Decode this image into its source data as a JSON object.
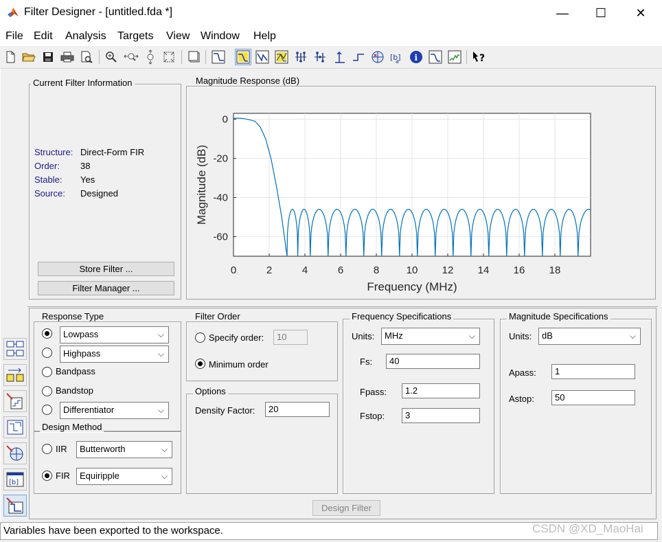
{
  "window": {
    "title": "Filter Designer -  [untitled.fda *]",
    "controls": {
      "minimize": "—",
      "maximize": "☐",
      "close": "✕"
    }
  },
  "menu": [
    "File",
    "Edit",
    "Analysis",
    "Targets",
    "View",
    "Window",
    "Help"
  ],
  "filter_info": {
    "title": "Current Filter Information",
    "rows": [
      {
        "label": "Structure:",
        "value": "Direct-Form FIR"
      },
      {
        "label": "Order:",
        "value": "38"
      },
      {
        "label": "Stable:",
        "value": "Yes"
      },
      {
        "label": "Source:",
        "value": "Designed"
      }
    ],
    "store_button": "Store Filter ...",
    "manager_button": "Filter Manager ..."
  },
  "plot": {
    "title": "Magnitude Response (dB)",
    "xlabel": "Frequency (MHz)",
    "ylabel": "Magnitude (dB)",
    "xticks": [
      "0",
      "2",
      "4",
      "6",
      "8",
      "10",
      "12",
      "14",
      "16",
      "18"
    ],
    "yticks": [
      "0",
      "-20",
      "-40",
      "-60"
    ],
    "line_color": "#0072bd"
  },
  "chart_data": {
    "type": "line",
    "title": "",
    "xlabel": "Frequency (MHz)",
    "ylabel": "Magnitude (dB)",
    "xlim": [
      0,
      20
    ],
    "ylim": [
      -70,
      3
    ],
    "grid": true,
    "series": [
      {
        "passband_x": [
          0,
          0.3,
          0.6,
          0.9,
          1.2,
          1.5,
          1.8,
          2.1,
          2.4,
          2.7,
          3.0
        ],
        "passband_y": [
          0.5,
          0.5,
          0.3,
          -0.3,
          -1,
          -4,
          -10,
          -20,
          -34,
          -50,
          -70
        ],
        "ripple_peak_db": -46,
        "ripple_nulls_mhz": [
          3.0,
          3.6,
          4.3,
          5.3,
          6.3,
          7.3,
          8.3,
          9.3,
          10.3,
          11.3,
          12.3,
          13.3,
          14.3,
          15.3,
          16.3,
          17.3,
          18.3,
          19.3
        ]
      }
    ]
  },
  "response_type": {
    "title": "Response Type",
    "options": [
      {
        "label": "Lowpass",
        "selected": true,
        "dropdown": true
      },
      {
        "label": "Highpass",
        "selected": false,
        "dropdown": true
      },
      {
        "label": "Bandpass",
        "selected": false,
        "dropdown": false
      },
      {
        "label": "Bandstop",
        "selected": false,
        "dropdown": false
      },
      {
        "label": "Differentiator",
        "selected": false,
        "dropdown": true
      }
    ]
  },
  "design_method": {
    "title": "Design Method",
    "iir_label": "IIR",
    "iir_value": "Butterworth",
    "fir_label": "FIR",
    "fir_value": "Equiripple"
  },
  "filter_order": {
    "title": "Filter Order",
    "specify_label": "Specify order:",
    "specify_value": "10",
    "minimum_label": "Minimum order"
  },
  "options": {
    "title": "Options",
    "density_label": "Density Factor:",
    "density_value": "20"
  },
  "freq_specs": {
    "title": "Frequency Specifications",
    "units_label": "Units:",
    "units_value": "MHz",
    "fs_label": "Fs:",
    "fs_value": "40",
    "fpass_label": "Fpass:",
    "fpass_value": "1.2",
    "fstop_label": "Fstop:",
    "fstop_value": "3"
  },
  "mag_specs": {
    "title": "Magnitude Specifications",
    "units_label": "Units:",
    "units_value": "dB",
    "apass_label": "Apass:",
    "apass_value": "1",
    "astop_label": "Astop:",
    "astop_value": "50"
  },
  "design_button": "Design Filter",
  "status": "Variables have been exported to the workspace.",
  "watermark": "CSDN @XD_MaoHai"
}
